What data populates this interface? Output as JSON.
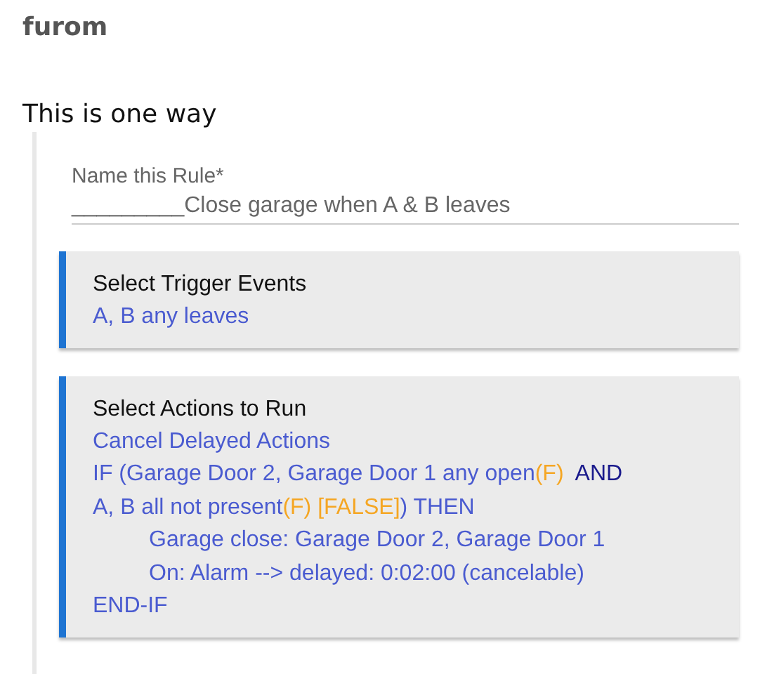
{
  "post": {
    "author": "furom",
    "text": "This is one way"
  },
  "rule_name": {
    "label": "Name this Rule*",
    "value": "_________Close garage when A & B leaves"
  },
  "sections": [
    {
      "title": "Select Trigger Events",
      "lines": [
        {
          "indented": false,
          "segments": [
            {
              "text": "A, B any leaves",
              "color": "#4a5bd0"
            }
          ]
        }
      ]
    },
    {
      "title": "Select Actions to Run",
      "lines": [
        {
          "indented": false,
          "segments": [
            {
              "text": "Cancel Delayed Actions",
              "color": "#4a5bd0"
            }
          ]
        },
        {
          "indented": false,
          "segments": [
            {
              "text": "IF (Garage Door 2, Garage Door 1 any open",
              "color": "#4a5bd0"
            },
            {
              "text": "(F)",
              "color": "#f5a623"
            },
            {
              "text": "  AND",
              "color": "#1a1a8c"
            }
          ]
        },
        {
          "indented": false,
          "segments": [
            {
              "text": "A, B all not present",
              "color": "#4a5bd0"
            },
            {
              "text": "(F) [FALSE]",
              "color": "#f5a623"
            },
            {
              "text": ") THEN",
              "color": "#4a5bd0"
            }
          ]
        },
        {
          "indented": true,
          "segments": [
            {
              "text": "Garage close: Garage Door 2, Garage Door 1",
              "color": "#4a5bd0"
            }
          ]
        },
        {
          "indented": true,
          "segments": [
            {
              "text": "On: Alarm --> delayed: 0:02:00 (cancelable)",
              "color": "#4a5bd0"
            }
          ]
        },
        {
          "indented": false,
          "segments": [
            {
              "text": "END-IF",
              "color": "#4a5bd0"
            }
          ]
        }
      ]
    }
  ]
}
